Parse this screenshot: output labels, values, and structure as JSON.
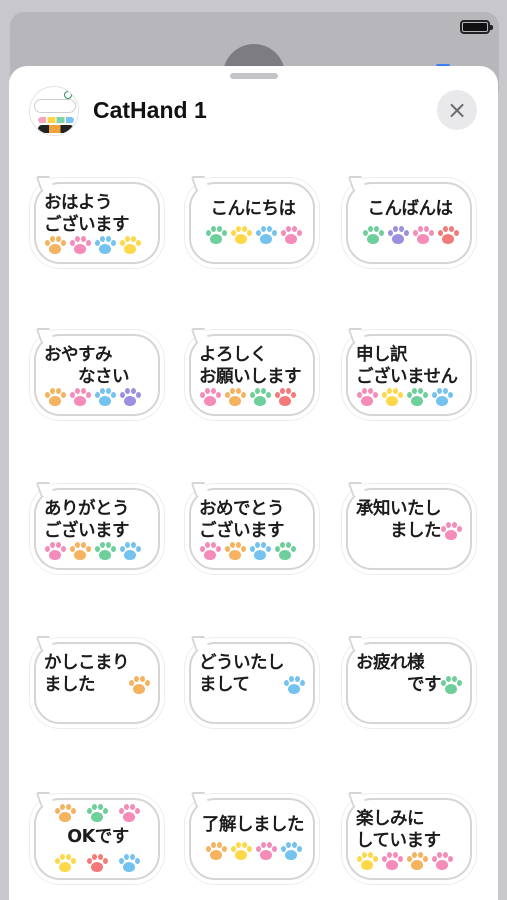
{
  "status_bar": {
    "battery": "full"
  },
  "sheet": {
    "title": "CatHand 1",
    "close_icon": "×"
  },
  "colors": {
    "yellow": "#ffd84a",
    "pink": "#f58bb8",
    "blue": "#74c3ef",
    "green": "#6ecf9a",
    "orange": "#f5b25f",
    "purple": "#9b8fe0",
    "red": "#f47a7a"
  },
  "stickers": [
    {
      "text": "おはよう\nございます",
      "align": "left",
      "paws": [
        "orange",
        "pink",
        "blue",
        "yellow"
      ]
    },
    {
      "text": "こんにちは",
      "align": "center",
      "paws": [
        "green",
        "yellow",
        "blue",
        "pink"
      ]
    },
    {
      "text": "こんばんは",
      "align": "center",
      "paws": [
        "green",
        "purple",
        "pink",
        "red"
      ]
    },
    {
      "text": "おやすみ\n　　なさい",
      "align": "left",
      "paws": [
        "orange",
        "pink",
        "blue",
        "purple"
      ]
    },
    {
      "text": "よろしく\nお願いします",
      "align": "left",
      "paws": [
        "pink",
        "orange",
        "green",
        "red"
      ]
    },
    {
      "text": "申し訳\nございません",
      "align": "left",
      "paws": [
        "pink",
        "yellow",
        "green",
        "blue"
      ]
    },
    {
      "text": "ありがとう\nございます",
      "align": "left",
      "paws": [
        "pink",
        "orange",
        "green",
        "blue"
      ]
    },
    {
      "text": "おめでとう\nございます",
      "align": "left",
      "paws": [
        "pink",
        "orange",
        "blue",
        "green"
      ]
    },
    {
      "text": "承知いたし\n　　ました",
      "align": "left",
      "paws": [
        "pink"
      ],
      "paws_pos": "inline"
    },
    {
      "text": "かしこまり\nました",
      "align": "left",
      "paws": [
        "orange"
      ],
      "paws_pos": "inline"
    },
    {
      "text": "どういたし\nまして",
      "align": "left",
      "paws": [
        "blue"
      ],
      "paws_pos": "inline"
    },
    {
      "text": "お疲れ様\n　　　です",
      "align": "left",
      "paws": [
        "green"
      ],
      "paws_pos": "inline"
    },
    {
      "text": "OKです",
      "align": "center",
      "paws": [
        "orange",
        "green",
        "pink",
        "yellow",
        "red",
        "blue"
      ],
      "paws_pos": "split"
    },
    {
      "text": "了解しました",
      "align": "center",
      "paws": [
        "orange",
        "yellow",
        "pink",
        "blue"
      ]
    },
    {
      "text": "楽しみに\nしています",
      "align": "left",
      "paws": [
        "yellow",
        "pink",
        "orange",
        "pink"
      ]
    }
  ]
}
